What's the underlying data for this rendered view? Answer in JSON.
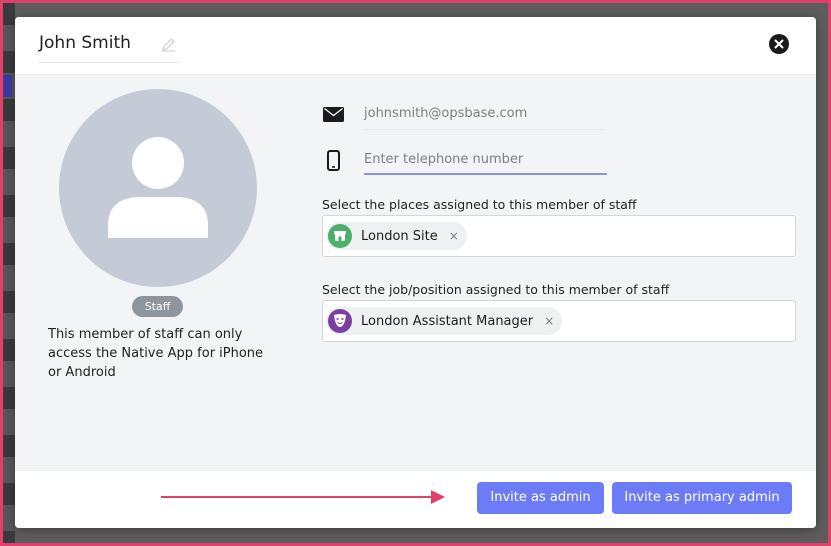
{
  "colors": {
    "accent": "#6b7cf6",
    "annotation": "#e0406a",
    "avatar_bg": "#c4cad6",
    "place_icon": "#4caf6a",
    "position_icon": "#7b3fa0"
  },
  "header": {
    "name": "John Smith",
    "edit_icon": "pencil-icon",
    "close_icon": "close-icon"
  },
  "profile": {
    "avatar_icon": "user-silhouette-icon",
    "role_badge": "Staff",
    "access_note": "This member of staff can only access the Native App for iPhone or Android"
  },
  "contact": {
    "email_icon": "envelope-icon",
    "email": "johnsmith@opsbase.com",
    "phone_icon": "mobile-phone-icon",
    "phone_value": "",
    "phone_placeholder": "Enter telephone number"
  },
  "places": {
    "label": "Select the places assigned to this member of staff",
    "selected": [
      {
        "label": "London Site",
        "icon": "store-icon",
        "remove": "×"
      }
    ]
  },
  "positions": {
    "label": "Select the job/position assigned to this member of staff",
    "selected": [
      {
        "label": "London Assistant Manager",
        "icon": "theatre-mask-icon",
        "remove": "×"
      }
    ]
  },
  "footer": {
    "annotation_icon": "arrow-right-icon",
    "invite_admin": "Invite as admin",
    "invite_primary_admin": "Invite as primary admin"
  }
}
